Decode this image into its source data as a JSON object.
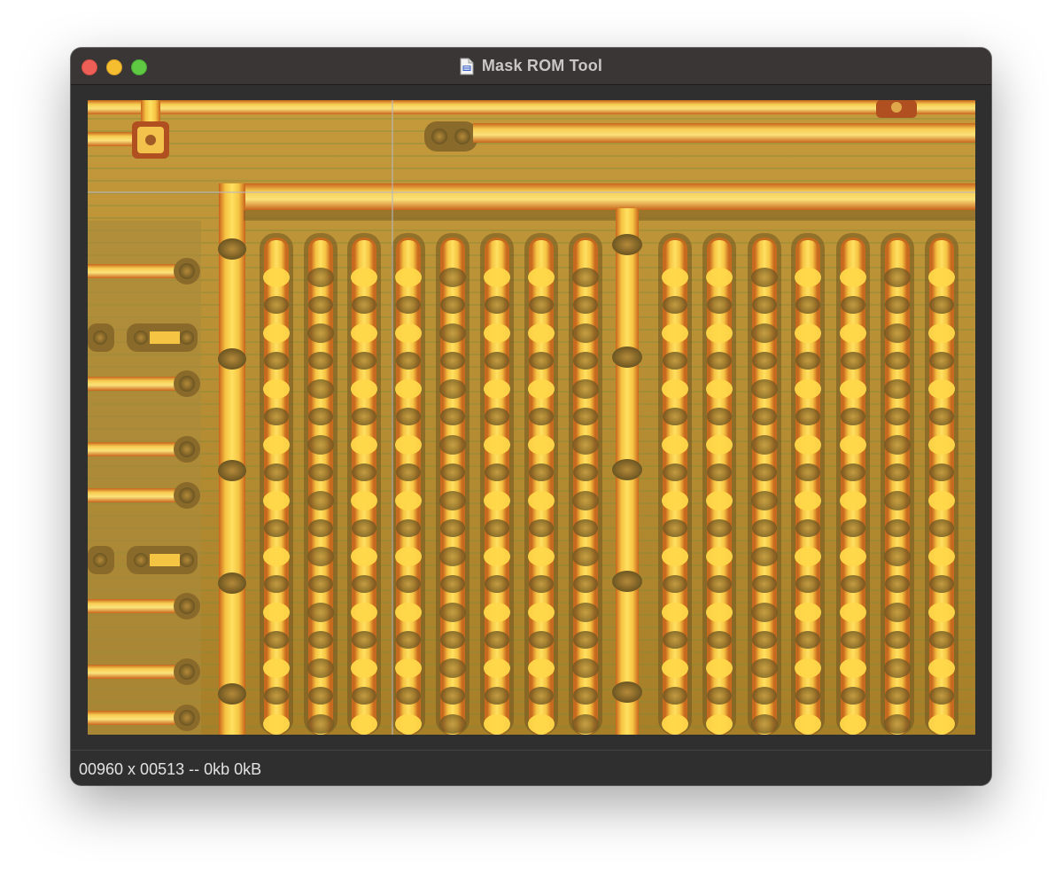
{
  "window": {
    "title": "Mask ROM Tool"
  },
  "icons": {
    "close": "close-button",
    "minimize": "minimize-button",
    "zoom": "zoom-button",
    "document": "document-icon"
  },
  "colors": {
    "titlebar": "#3a3636",
    "window_bg": "#2f2f2f",
    "die_base": "#b89030",
    "metal": "#f7c94a",
    "cursor_line": "#b8b8c0"
  },
  "viewer": {
    "content": "die photograph of mask ROM bit array"
  },
  "status": {
    "text": "00960 x 00513 -- 0kb 0kB"
  }
}
